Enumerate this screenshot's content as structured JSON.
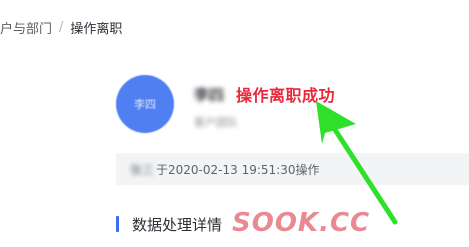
{
  "breadcrumb": {
    "parent": "户与部门",
    "separator": "/",
    "current": "操作离职"
  },
  "result": {
    "avatar_text": "李四",
    "user_name": "李四",
    "status": "操作离职成功",
    "department": "客户团队"
  },
  "operation": {
    "operator": "张三",
    "message": "于2020-02-13 19:51:30操作"
  },
  "section": {
    "title": "数据处理详情"
  },
  "watermark": {
    "text": "SOOK.CC"
  },
  "colors": {
    "accent": "#3b6cf6",
    "avatar": "#4f7ff0",
    "success_text": "#e8293a",
    "annotation_arrow": "#2ee02a"
  },
  "icons": {
    "annotation": "green-arrow-icon"
  }
}
